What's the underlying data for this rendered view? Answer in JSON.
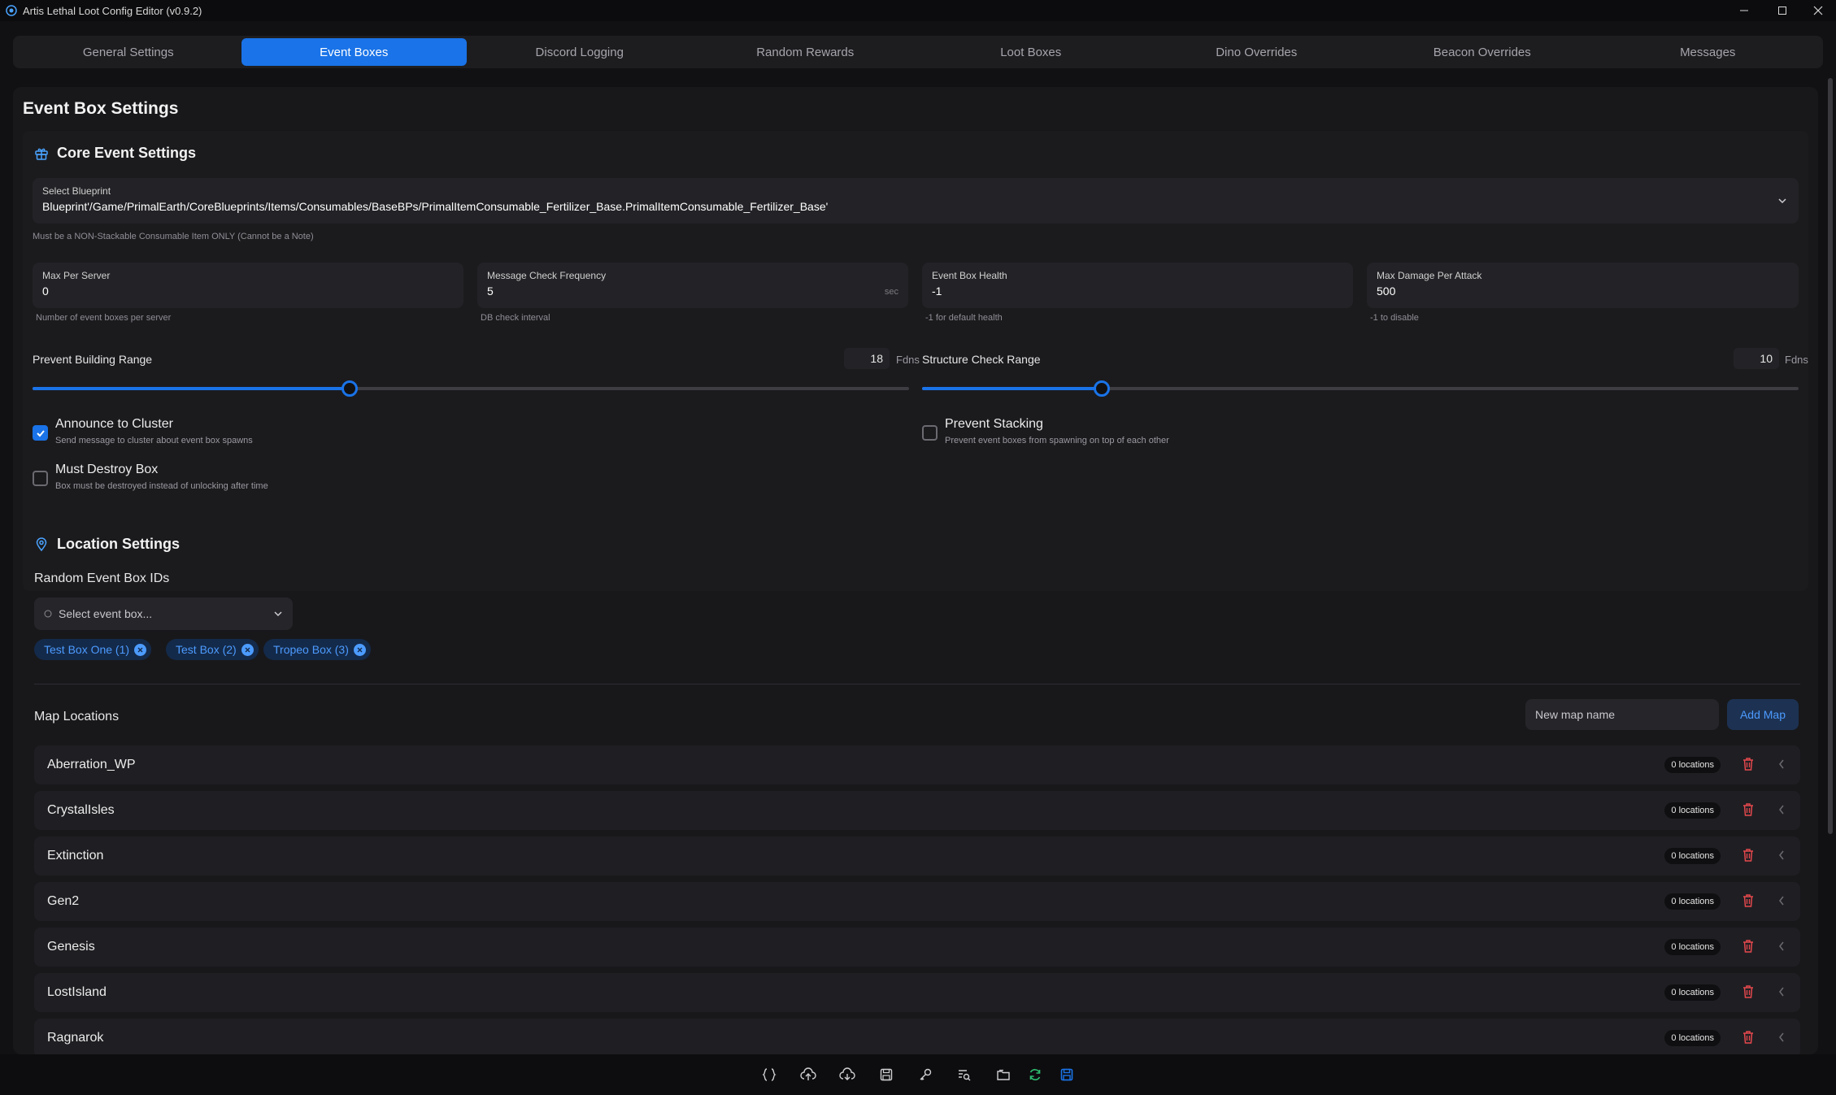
{
  "window": {
    "title": "Artis Lethal Loot Config Editor (v0.9.2)"
  },
  "tabs": [
    {
      "label": "General Settings",
      "active": false
    },
    {
      "label": "Event Boxes",
      "active": true
    },
    {
      "label": "Discord Logging",
      "active": false
    },
    {
      "label": "Random Rewards",
      "active": false
    },
    {
      "label": "Loot Boxes",
      "active": false
    },
    {
      "label": "Dino Overrides",
      "active": false
    },
    {
      "label": "Beacon Overrides",
      "active": false
    },
    {
      "label": "Messages",
      "active": false
    }
  ],
  "page": {
    "title": "Event Box Settings"
  },
  "core": {
    "title": "Core Event Settings",
    "blueprint": {
      "label": "Select Blueprint",
      "value": "Blueprint'/Game/PrimalEarth/CoreBlueprints/Items/Consumables/BaseBPs/PrimalItemConsumable_Fertilizer_Base.PrimalItemConsumable_Fertilizer_Base'",
      "hint": "Must be a NON-Stackable Consumable Item ONLY (Cannot be a Note)"
    },
    "max_per_server": {
      "label": "Max Per Server",
      "value": "0",
      "hint": "Number of event boxes per server"
    },
    "message_check_frequency": {
      "label": "Message Check Frequency",
      "value": "5",
      "unit": "sec",
      "hint": "DB check interval"
    },
    "event_box_health": {
      "label": "Event Box Health",
      "value": "-1",
      "hint": "-1 for default health"
    },
    "max_damage_per_attack": {
      "label": "Max Damage Per Attack",
      "value": "500",
      "hint": "-1 to disable"
    },
    "prevent_building_range": {
      "label": "Prevent Building Range",
      "value": "18",
      "unit": "Fdns",
      "level": 0.362
    },
    "structure_check_range": {
      "label": "Structure Check Range",
      "value": "10",
      "unit": "Fdns",
      "level": 0.205
    },
    "announce_to_cluster": {
      "title": "Announce to Cluster",
      "sub": "Send message to cluster about event box spawns",
      "checked": true
    },
    "prevent_stacking": {
      "title": "Prevent Stacking",
      "sub": "Prevent event boxes from spawning on top of each other",
      "checked": false
    },
    "must_destroy_box": {
      "title": "Must Destroy Box",
      "sub": "Box must be destroyed instead of unlocking after time",
      "checked": false
    }
  },
  "location": {
    "title": "Location Settings",
    "random_ids_label": "Random Event Box IDs",
    "select_placeholder": "Select event box...",
    "chips": [
      "Test Box One (1)",
      "Test Box (2)",
      "Tropeo Box (3)"
    ],
    "map_locations_label": "Map Locations",
    "new_map_placeholder": "New map name",
    "add_map_label": "Add Map",
    "maps": [
      {
        "name": "Aberration_WP",
        "count": "0 locations"
      },
      {
        "name": "CrystalIsles",
        "count": "0 locations"
      },
      {
        "name": "Extinction",
        "count": "0 locations"
      },
      {
        "name": "Gen2",
        "count": "0 locations"
      },
      {
        "name": "Genesis",
        "count": "0 locations"
      },
      {
        "name": "LostIsland",
        "count": "0 locations"
      },
      {
        "name": "Ragnarok",
        "count": "0 locations"
      }
    ]
  },
  "colors": {
    "accent": "#1a73e8",
    "danger": "#e5484d",
    "success": "#2fbf71"
  },
  "toolbar_icons": [
    "braces-icon",
    "cloud-upload-icon",
    "cloud-download-icon",
    "save-file-icon",
    "key-icon",
    "search-list-icon",
    "folder-icon",
    "refresh-icon",
    "save-icon"
  ]
}
